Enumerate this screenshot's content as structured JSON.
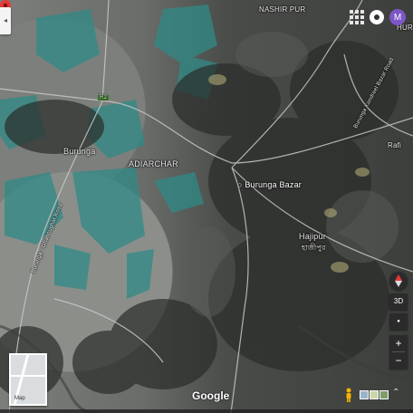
{
  "map": {
    "labels": {
      "nashir_pur": "NASHIR PUR",
      "burunga": "Burunga",
      "adiarchar": "ADIARCHAR",
      "hajipur": "Hajipur",
      "hajipur_bn": "হাজীপুর",
      "road_r2": "R2",
      "rafi": "Rafi",
      "road_diagonal_left": "Burunga - Ghahoughat Road",
      "road_diagonal_right": "Burunga Kendreel Bazar Road",
      "hur": "HUR"
    },
    "pin": {
      "name": "Burunga Bazar",
      "color": "#e53935"
    }
  },
  "controls": {
    "back_symbol": "◂",
    "avatar_letter": "M",
    "avatar_color": "#7b57c7",
    "minimap_label": "Map",
    "google_logo": "Google",
    "tilt_label": "3D",
    "zoom_in": "+",
    "zoom_out": "−",
    "chevron": "⌃"
  }
}
